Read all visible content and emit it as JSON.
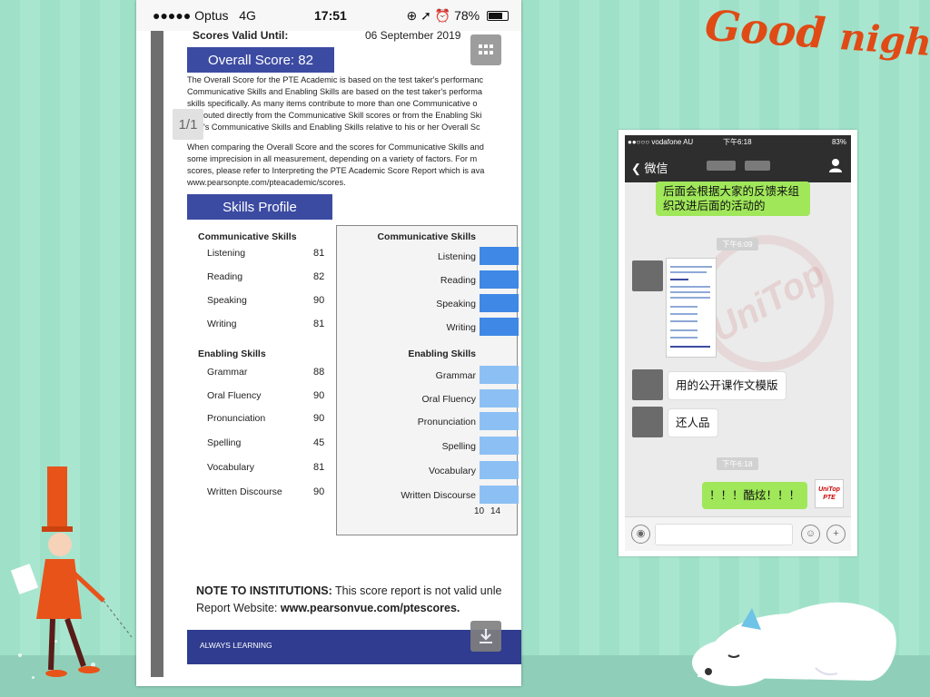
{
  "background": {
    "color": "#a3e2cc",
    "floor_color": "#8fcfb9"
  },
  "decoration": {
    "headline_word1": "Good",
    "headline_word2": "night",
    "headline_color": "#e04a14"
  },
  "left_phone": {
    "status": {
      "carrier": "●●●●● Optus",
      "network": "4G",
      "time": "17:51",
      "icons": "⊕ ➚ ⏰",
      "battery": "78%"
    },
    "page_badge": "1/1",
    "scores_valid": {
      "label": "Scores Valid Until:",
      "date": "06 September 2019"
    },
    "overall_score": "Overall Score: 82",
    "paragraph1": [
      "The Overall Score for the PTE Academic is based on the test taker's performanc",
      "Communicative Skills and Enabling Skills are based on the test taker's performa",
      "skills specifically.  As many items contribute to more than one Communicative o",
      "outed directly from the Communicative Skill scores or from the Enabling Ski",
      "'s Communicative Skills and Enabling Skills relative to his or her Overall Sc"
    ],
    "paragraph2": [
      "When comparing the Overall Score and the scores for Communicative Skills and",
      "some imprecision in all measurement, depending on a variety of factors.  For m",
      "scores, please refer to Interpreting the PTE Academic Score Report which is ava",
      "www.pearsonpte.com/pteacademic/scores."
    ],
    "skills_profile_title": "Skills Profile",
    "communicative_heading": "Communicative Skills",
    "enabling_heading": "Enabling Skills",
    "communicative": [
      {
        "label": "Listening",
        "score": "81"
      },
      {
        "label": "Reading",
        "score": "82"
      },
      {
        "label": "Speaking",
        "score": "90"
      },
      {
        "label": "Writing",
        "score": "81"
      }
    ],
    "enabling": [
      {
        "label": "Grammar",
        "score": "88"
      },
      {
        "label": "Oral Fluency",
        "score": "90"
      },
      {
        "label": "Pronunciation",
        "score": "90"
      },
      {
        "label": "Spelling",
        "score": "45"
      },
      {
        "label": "Vocabulary",
        "score": "81"
      },
      {
        "label": "Written Discourse",
        "score": "90"
      }
    ],
    "chart_ticks": [
      "10",
      "14"
    ],
    "chart_colors": {
      "communicative": "#3f88e6",
      "enabling": "#8cc0f4",
      "header": "#3c4ba2"
    },
    "note_label": "NOTE TO INSTITUTIONS:",
    "note_text": " This score report is not valid unle",
    "report_website_label": "Report Website: ",
    "report_website_url": "www.pearsonvue.com/ptescores.",
    "footer": "ALWAYS LEARNING"
  },
  "right_phone": {
    "status": {
      "carrier": "●●○○○ vodafone AU",
      "time": "下午6:18",
      "battery": "83%"
    },
    "back_label": "微信",
    "messages": {
      "top_bubble": [
        "后面会根据大家的反馈来组",
        "织改进后面的活动的"
      ],
      "time1": "下午6:09",
      "bubble1": "用的公开课作文模版",
      "bubble2": "还人品",
      "time2": "下午6:18",
      "bubble3": "！！！酷炫！！！"
    },
    "avatar_text": "UniTop PTE"
  }
}
